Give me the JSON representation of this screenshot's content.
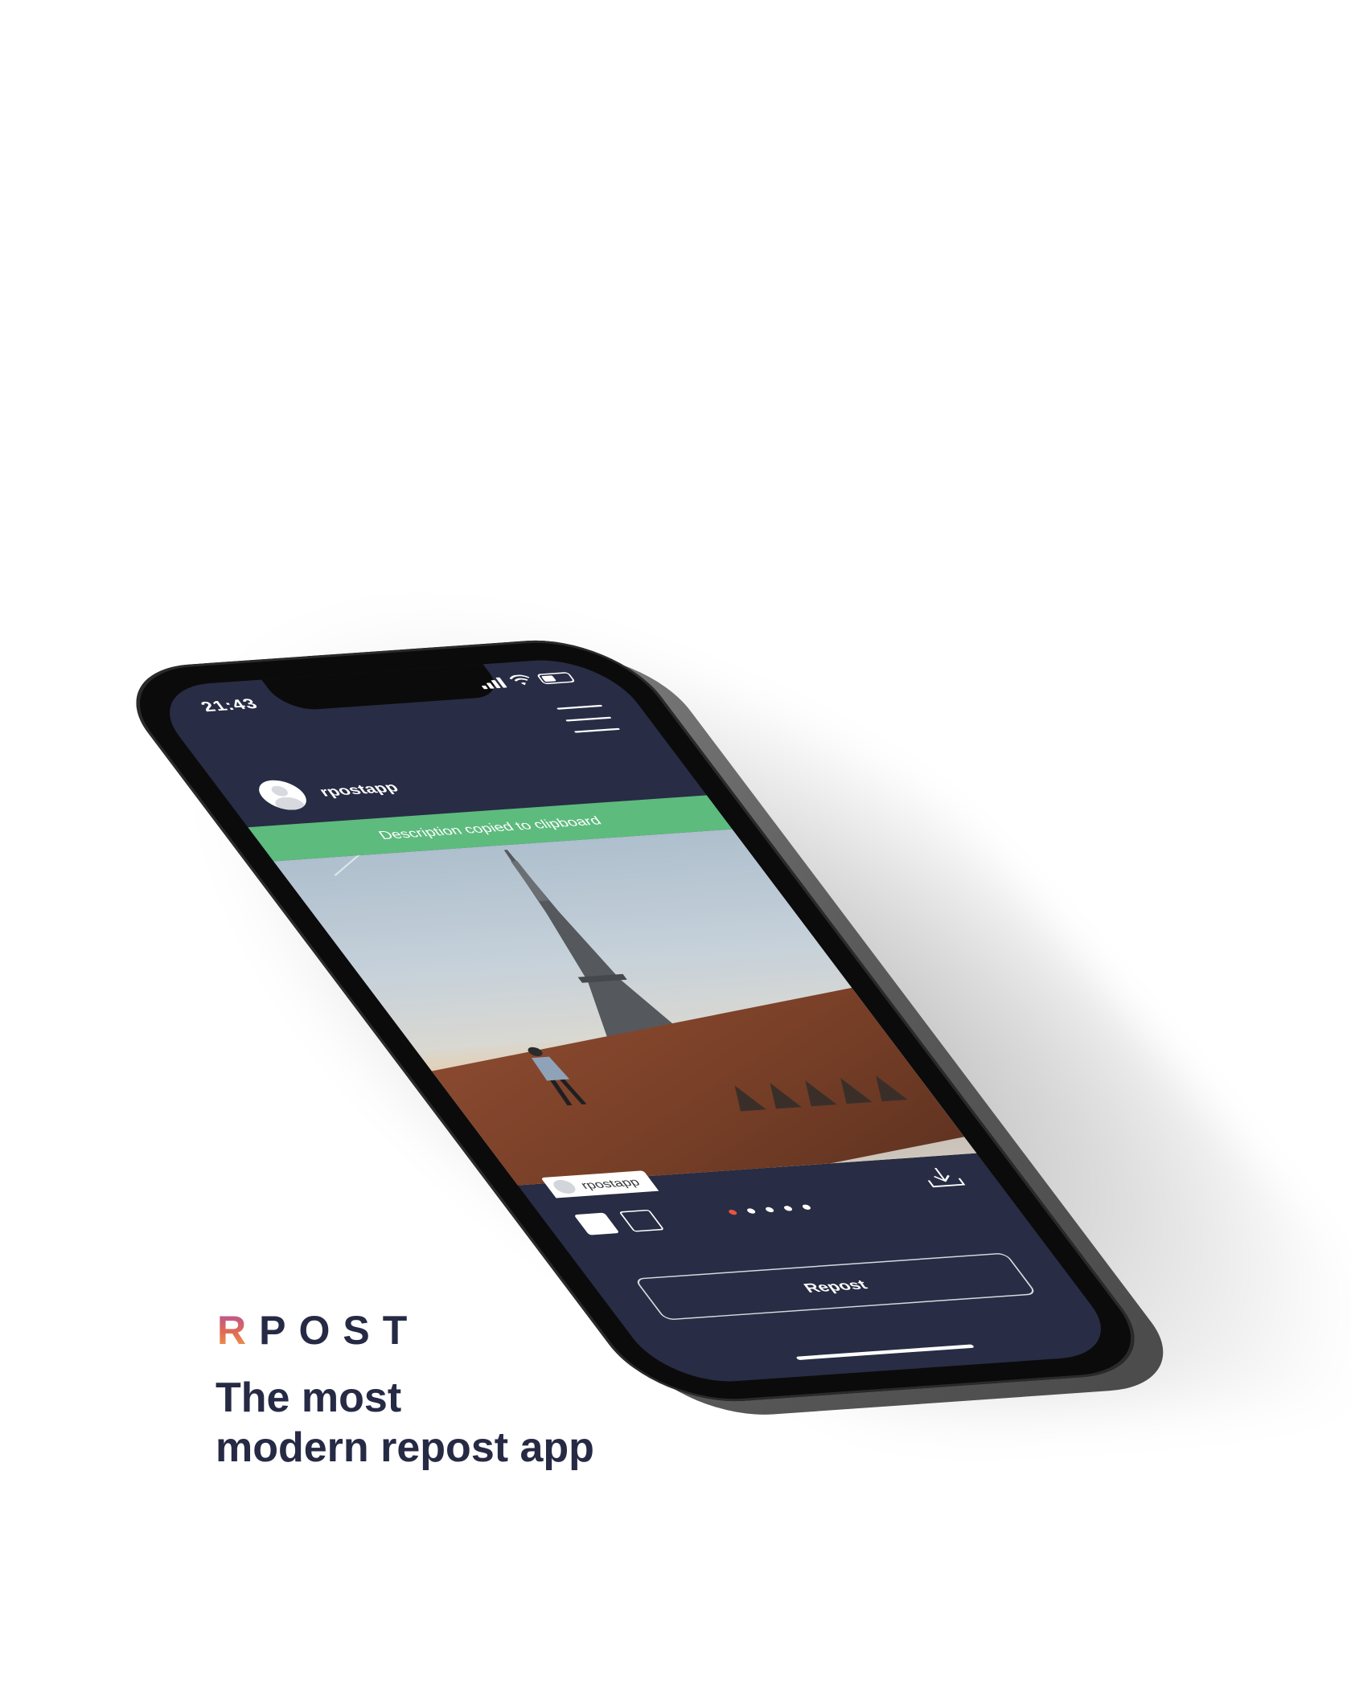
{
  "brand": {
    "logo_first_letter": "R",
    "logo_rest": "POST",
    "tagline_line1": "The most",
    "tagline_line2": "modern repost app",
    "text_color": "#262a44"
  },
  "phone": {
    "status_bar": {
      "time": "21:43",
      "icons": [
        "cellular-signal-icon",
        "wifi-icon",
        "battery-icon"
      ],
      "battery_level": 0.4
    },
    "header": {
      "menu_icon": "hamburger-menu-icon",
      "username": "rpostapp",
      "avatar_icon": "default-avatar-icon"
    },
    "toast": {
      "message": "Description copied to clipboard",
      "color": "#5dbb7d"
    },
    "post": {
      "image_subject": "eiffel-tower-photo",
      "watermark_username": "rpostapp"
    },
    "controls": {
      "download_icon": "download-icon",
      "layout_options": [
        "watermark-corner-option",
        "watermark-none-option"
      ],
      "selected_layout": 0,
      "carousel_count": 5,
      "carousel_active_index": 0,
      "repost_label": "Repost"
    },
    "colors": {
      "screen_bg": "#282c44",
      "accent_dot": "#e5553f"
    }
  }
}
